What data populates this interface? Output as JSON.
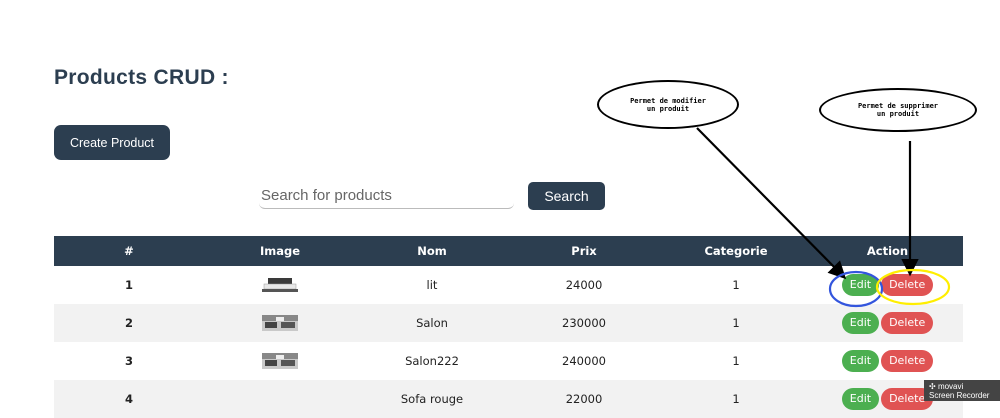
{
  "page": {
    "title": "Products CRUD :",
    "create_label": "Create Product",
    "search_placeholder": "Search for products",
    "search_label": "Search"
  },
  "table": {
    "headers": [
      "#",
      "Image",
      "Nom",
      "Prix",
      "Categorie",
      "Action"
    ],
    "edit_label": "Edit",
    "delete_label": "Delete",
    "rows": [
      {
        "id": "1",
        "image": "bed-image",
        "nom": "lit",
        "prix": "24000",
        "categorie": "1"
      },
      {
        "id": "2",
        "image": "living-room-image",
        "nom": "Salon",
        "prix": "230000",
        "categorie": "1"
      },
      {
        "id": "3",
        "image": "living-room-image",
        "nom": "Salon222",
        "prix": "240000",
        "categorie": "1"
      },
      {
        "id": "4",
        "image": "",
        "nom": "Sofa rouge",
        "prix": "22000",
        "categorie": "1"
      }
    ]
  },
  "annotations": {
    "edit_note": "Permet de modifier un produit",
    "delete_note": "Permet de supprimer un produit",
    "edit_circle_color": "#3355dd",
    "delete_circle_color": "#ffee00"
  },
  "watermark": {
    "brand": "movavi",
    "product": "Screen Recorder"
  },
  "colors": {
    "header_bg": "#2c3e50",
    "edit": "#4caf50",
    "delete": "#e05353"
  }
}
